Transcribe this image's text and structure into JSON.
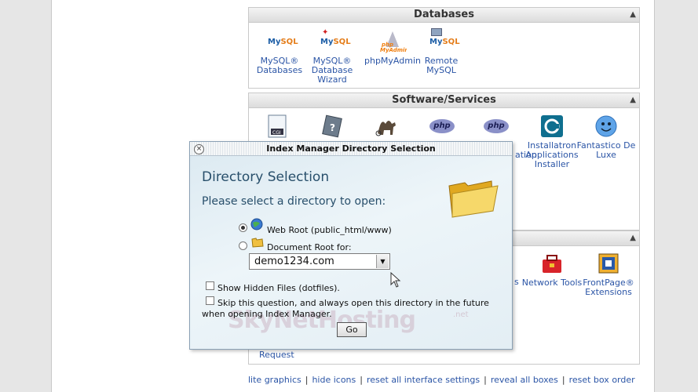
{
  "databases": {
    "title": "Databases",
    "items": [
      {
        "label": "MySQL® Databases",
        "icon": "mysql-databases-icon"
      },
      {
        "label": "MySQL® Database Wizard",
        "icon": "mysql-wizard-icon"
      },
      {
        "label": "phpMyAdmin",
        "icon": "phpmyadmin-icon"
      },
      {
        "label": "Remote MySQL",
        "icon": "remote-mysql-icon"
      }
    ]
  },
  "software": {
    "title": "Software/Services",
    "partial_label": "ation",
    "items": [
      {
        "label": "Installatron Applications Installer",
        "icon": "installatron-icon"
      },
      {
        "label": "Fantastico De Luxe",
        "icon": "fantastico-icon"
      }
    ]
  },
  "advanced": {
    "partial_label": "s",
    "items": [
      {
        "label": "Network Tools",
        "icon": "network-tools-icon"
      },
      {
        "label": "FrontPage® Extensions",
        "icon": "frontpage-icon"
      }
    ],
    "request_label": "Request"
  },
  "footer_links": {
    "lite_graphics": "lite graphics",
    "hide_icons": "hide icons",
    "reset_settings": "reset all interface settings",
    "reveal_boxes": "reveal all boxes",
    "reset_box_order": "reset box order"
  },
  "dialog": {
    "title": "Index Manager Directory Selection",
    "heading": "Directory Selection",
    "prompt": "Please select a directory to open:",
    "web_root_label": "Web Root (public_html/www)",
    "doc_root_label": "Document Root for:",
    "domain_value": "demo1234.com",
    "show_hidden_label": "Show Hidden Files (dotfiles).",
    "skip_label": "Skip this question, and always open this directory in the future when opening Index Manager.",
    "go_label": "Go",
    "watermark": "SkyNetHosting",
    "watermark_tld": ".net"
  },
  "colors": {
    "link": "#2b55a6",
    "heading": "#284f6b"
  }
}
